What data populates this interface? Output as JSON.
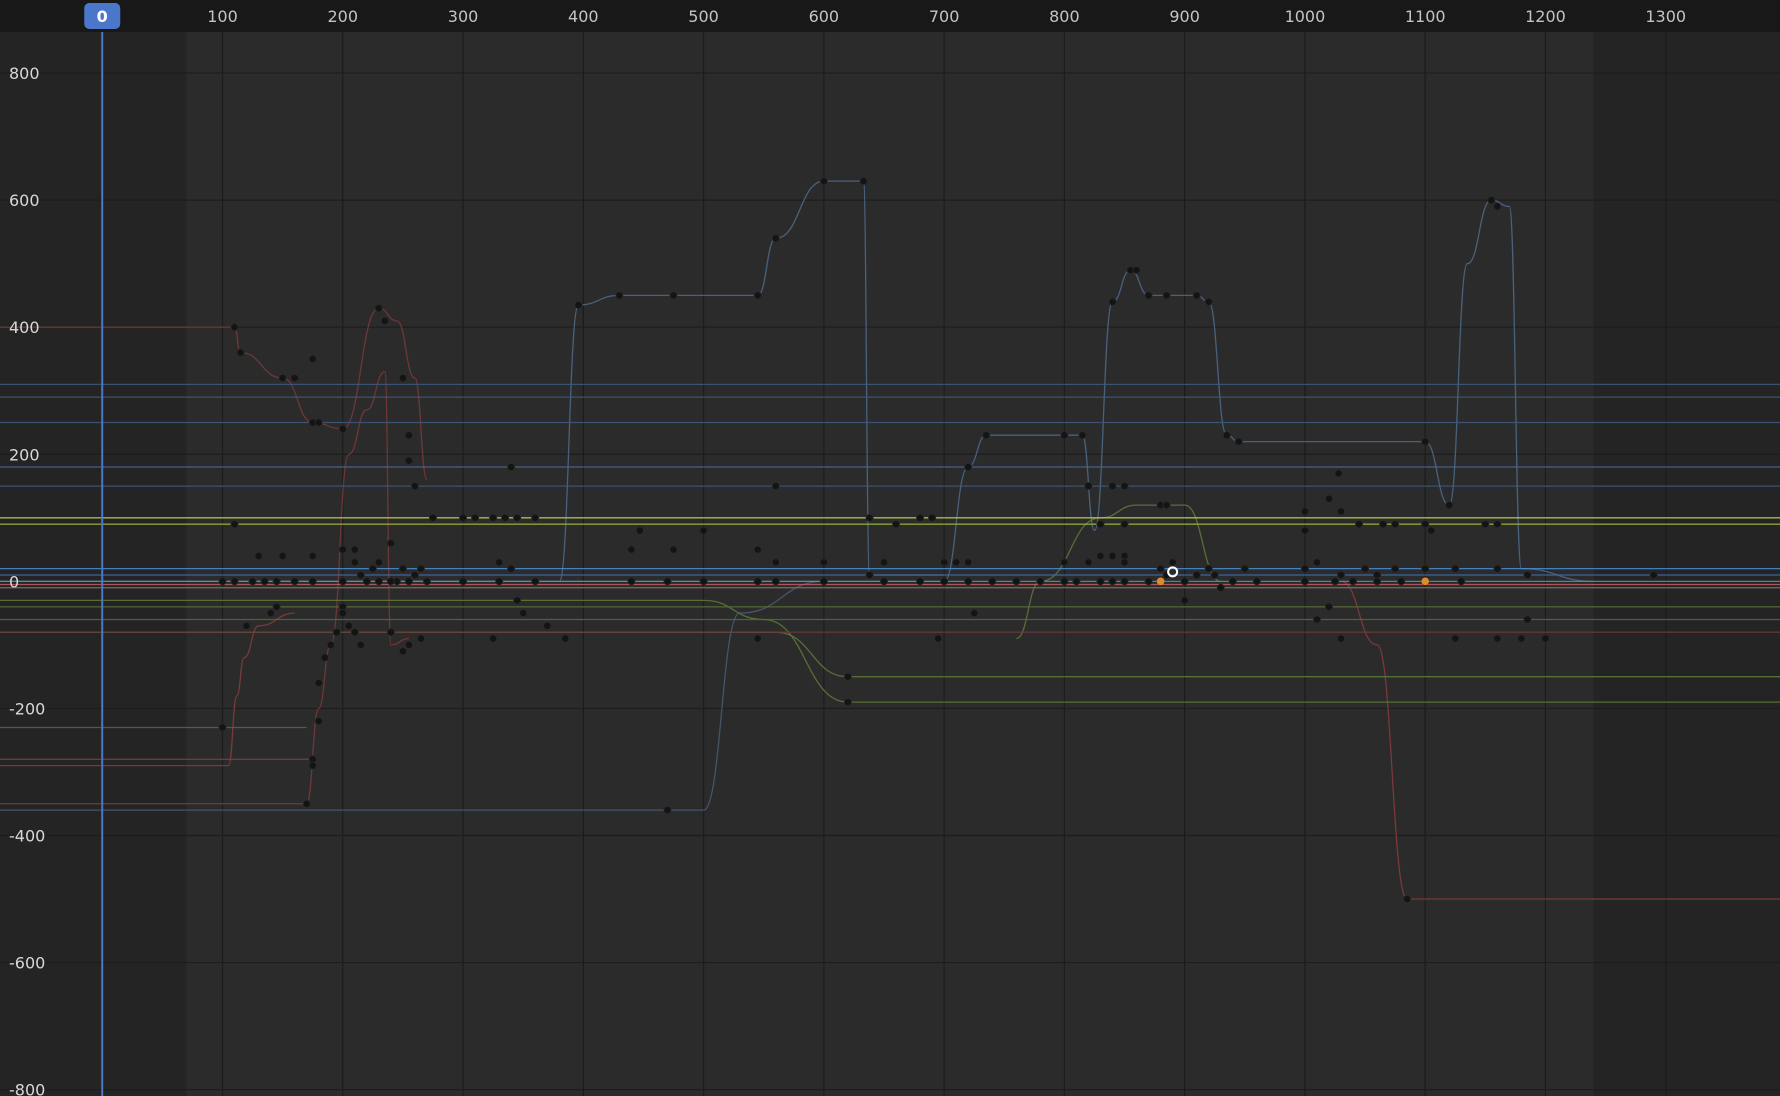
{
  "editor": {
    "type": "graph-editor",
    "current_frame": "0",
    "frame_range": {
      "start": 70,
      "end": 1240
    },
    "frame_ticks": [
      "100",
      "200",
      "300",
      "400",
      "500",
      "600",
      "700",
      "800",
      "900",
      "1000",
      "1100",
      "1200",
      "1300"
    ],
    "value_ticks": [
      "800",
      "600",
      "400",
      "200",
      "0",
      "-200",
      "-400",
      "-600",
      "-800"
    ],
    "colors": {
      "background": "#242424",
      "range_fill": "#2b2b2b",
      "ruler": "#181818",
      "playhead": "#4a77c9",
      "grid": "#1c1c1c"
    }
  },
  "chart_data": {
    "type": "line",
    "xlim": [
      -85,
      1395
    ],
    "ylim": [
      -810,
      915
    ],
    "grid": true,
    "series": [
      {
        "color": "#4d6b8c",
        "points": [
          [
            -90,
            0
          ],
          [
            380,
            0
          ],
          [
            396,
            435
          ],
          [
            430,
            450
          ],
          [
            475,
            450
          ],
          [
            545,
            450
          ],
          [
            560,
            540
          ],
          [
            600,
            630
          ],
          [
            633,
            630
          ],
          [
            638,
            10
          ],
          [
            700,
            10
          ]
        ]
      },
      {
        "color": "#4d6b8c",
        "points": [
          [
            -90,
            0
          ],
          [
            700,
            0
          ],
          [
            720,
            180
          ],
          [
            735,
            230
          ],
          [
            800,
            230
          ],
          [
            815,
            230
          ],
          [
            825,
            80
          ],
          [
            840,
            440
          ],
          [
            855,
            490
          ],
          [
            870,
            450
          ],
          [
            885,
            450
          ],
          [
            910,
            450
          ],
          [
            920,
            440
          ],
          [
            935,
            230
          ],
          [
            945,
            220
          ],
          [
            1100,
            220
          ],
          [
            1120,
            120
          ],
          [
            1135,
            500
          ],
          [
            1155,
            600
          ],
          [
            1170,
            590
          ],
          [
            1180,
            20
          ],
          [
            1240,
            0
          ]
        ]
      },
      {
        "color": "#4a5d74",
        "points": [
          [
            -90,
            -360
          ],
          [
            470,
            -360
          ],
          [
            500,
            -360
          ],
          [
            530,
            -50
          ],
          [
            600,
            0
          ]
        ]
      },
      {
        "color": "#7a3a3a",
        "points": [
          [
            -90,
            400
          ],
          [
            110,
            400
          ],
          [
            115,
            360
          ],
          [
            150,
            320
          ],
          [
            175,
            250
          ],
          [
            200,
            240
          ],
          [
            230,
            430
          ],
          [
            245,
            410
          ],
          [
            260,
            320
          ],
          [
            270,
            160
          ]
        ]
      },
      {
        "color": "#7a3a3a",
        "points": [
          [
            -90,
            -350
          ],
          [
            170,
            -350
          ],
          [
            180,
            -200
          ],
          [
            190,
            -100
          ],
          [
            205,
            200
          ],
          [
            220,
            270
          ],
          [
            235,
            330
          ],
          [
            240,
            -100
          ],
          [
            255,
            -90
          ]
        ]
      },
      {
        "color": "#8a3c3c",
        "points": [
          [
            -90,
            -290
          ],
          [
            105,
            -290
          ],
          [
            112,
            -180
          ],
          [
            118,
            -120
          ],
          [
            130,
            -70
          ],
          [
            160,
            -50
          ]
        ]
      },
      {
        "color": "#8a3c3c",
        "points": [
          [
            1030,
            0
          ],
          [
            1060,
            -100
          ],
          [
            1085,
            -500
          ],
          [
            1395,
            -500
          ]
        ]
      },
      {
        "color": "#5f7a3a",
        "points": [
          [
            -90,
            -30
          ],
          [
            500,
            -30
          ],
          [
            550,
            -60
          ],
          [
            620,
            -190
          ],
          [
            1395,
            -190
          ]
        ]
      },
      {
        "color": "#5f7a3a",
        "points": [
          [
            -90,
            -80
          ],
          [
            560,
            -80
          ],
          [
            620,
            -150
          ],
          [
            1395,
            -150
          ]
        ]
      },
      {
        "color": "#5f7a3a",
        "points": [
          [
            760,
            -90
          ],
          [
            780,
            0
          ],
          [
            830,
            100
          ],
          [
            860,
            120
          ],
          [
            900,
            120
          ],
          [
            930,
            0
          ]
        ]
      },
      {
        "color": "#c4d44a",
        "points": [
          [
            -90,
            100
          ],
          [
            1395,
            100
          ]
        ]
      },
      {
        "color": "#9cb83a",
        "points": [
          [
            -90,
            90
          ],
          [
            1395,
            90
          ]
        ]
      },
      {
        "color": "#4b8fd6",
        "points": [
          [
            -90,
            20
          ],
          [
            1395,
            20
          ]
        ]
      },
      {
        "color": "#3f6fb0",
        "points": [
          [
            -90,
            10
          ],
          [
            1395,
            10
          ]
        ]
      },
      {
        "color": "#5b8fc7",
        "points": [
          [
            -90,
            0
          ],
          [
            1395,
            0
          ]
        ]
      },
      {
        "color": "#c06060",
        "points": [
          [
            -90,
            -5
          ],
          [
            1395,
            -5
          ]
        ]
      },
      {
        "color": "#8a6a6a",
        "points": [
          [
            -90,
            -10
          ],
          [
            1395,
            -10
          ]
        ]
      },
      {
        "color": "#4a6a9a",
        "points": [
          [
            -90,
            180
          ],
          [
            1395,
            180
          ]
        ]
      },
      {
        "color": "#3e5a80",
        "points": [
          [
            -90,
            150
          ],
          [
            1395,
            150
          ]
        ]
      },
      {
        "color": "#3e5a80",
        "points": [
          [
            -90,
            310
          ],
          [
            1395,
            310
          ]
        ]
      },
      {
        "color": "#3e5a80",
        "points": [
          [
            -90,
            290
          ],
          [
            1395,
            290
          ]
        ]
      },
      {
        "color": "#3e5a80",
        "points": [
          [
            -90,
            250
          ],
          [
            1395,
            250
          ]
        ]
      },
      {
        "color": "#566b3a",
        "points": [
          [
            -90,
            -40
          ],
          [
            1395,
            -40
          ]
        ]
      },
      {
        "color": "#566b3a",
        "points": [
          [
            -90,
            -60
          ],
          [
            1395,
            -60
          ]
        ]
      },
      {
        "color": "#6a3a3a",
        "points": [
          [
            -90,
            -80
          ],
          [
            1395,
            -80
          ]
        ]
      },
      {
        "color": "#566b3a",
        "points": [
          [
            -90,
            -230
          ],
          [
            170,
            -230
          ]
        ]
      },
      {
        "color": "#7a4040",
        "points": [
          [
            -90,
            -280
          ],
          [
            175,
            -280
          ]
        ]
      }
    ],
    "keyframes": [
      [
        396,
        435
      ],
      [
        430,
        450
      ],
      [
        475,
        450
      ],
      [
        545,
        450
      ],
      [
        560,
        540
      ],
      [
        600,
        630
      ],
      [
        633,
        630
      ],
      [
        638,
        100
      ],
      [
        638,
        10
      ],
      [
        720,
        180
      ],
      [
        735,
        230
      ],
      [
        800,
        230
      ],
      [
        815,
        230
      ],
      [
        840,
        440
      ],
      [
        855,
        490
      ],
      [
        860,
        490
      ],
      [
        870,
        450
      ],
      [
        885,
        450
      ],
      [
        910,
        450
      ],
      [
        920,
        440
      ],
      [
        935,
        230
      ],
      [
        945,
        220
      ],
      [
        1100,
        220
      ],
      [
        1120,
        120
      ],
      [
        1155,
        600
      ],
      [
        1160,
        590
      ],
      [
        470,
        -360
      ],
      [
        110,
        400
      ],
      [
        115,
        360
      ],
      [
        150,
        320
      ],
      [
        160,
        320
      ],
      [
        175,
        350
      ],
      [
        175,
        250
      ],
      [
        180,
        250
      ],
      [
        200,
        240
      ],
      [
        230,
        430
      ],
      [
        235,
        410
      ],
      [
        250,
        320
      ],
      [
        255,
        230
      ],
      [
        255,
        190
      ],
      [
        260,
        150
      ],
      [
        100,
        -230
      ],
      [
        170,
        -350
      ],
      [
        175,
        -280
      ],
      [
        175,
        -290
      ],
      [
        180,
        -220
      ],
      [
        180,
        -160
      ],
      [
        185,
        -120
      ],
      [
        190,
        -100
      ],
      [
        195,
        -80
      ],
      [
        200,
        -40
      ],
      [
        1085,
        -500
      ],
      [
        340,
        180
      ],
      [
        820,
        150
      ],
      [
        840,
        150
      ],
      [
        850,
        150
      ],
      [
        830,
        40
      ],
      [
        840,
        40
      ],
      [
        850,
        40
      ],
      [
        830,
        90
      ],
      [
        850,
        90
      ],
      [
        440,
        50
      ],
      [
        447,
        80
      ],
      [
        475,
        50
      ],
      [
        500,
        80
      ],
      [
        545,
        50
      ],
      [
        560,
        150
      ],
      [
        680,
        100
      ],
      [
        690,
        100
      ],
      [
        660,
        90
      ],
      [
        880,
        120
      ],
      [
        885,
        120
      ],
      [
        1020,
        130
      ],
      [
        1028,
        170
      ],
      [
        1000,
        110
      ],
      [
        1000,
        80
      ],
      [
        1030,
        110
      ],
      [
        1045,
        90
      ],
      [
        1065,
        90
      ],
      [
        1075,
        90
      ],
      [
        1100,
        90
      ],
      [
        1105,
        80
      ],
      [
        1150,
        90
      ],
      [
        1160,
        90
      ],
      [
        110,
        90
      ],
      [
        130,
        40
      ],
      [
        150,
        40
      ],
      [
        175,
        40
      ],
      [
        200,
        50
      ],
      [
        210,
        50
      ],
      [
        225,
        20
      ],
      [
        240,
        60
      ],
      [
        250,
        20
      ],
      [
        275,
        100
      ],
      [
        300,
        100
      ],
      [
        310,
        100
      ],
      [
        325,
        100
      ],
      [
        335,
        100
      ],
      [
        345,
        100
      ],
      [
        360,
        100
      ],
      [
        120,
        -70
      ],
      [
        140,
        -50
      ],
      [
        145,
        -40
      ],
      [
        200,
        -50
      ],
      [
        205,
        -70
      ],
      [
        210,
        -80
      ],
      [
        215,
        -100
      ],
      [
        240,
        -80
      ],
      [
        250,
        -110
      ],
      [
        255,
        -100
      ],
      [
        265,
        -90
      ],
      [
        325,
        -90
      ],
      [
        370,
        -70
      ],
      [
        385,
        -90
      ],
      [
        545,
        -90
      ],
      [
        620,
        -150
      ],
      [
        620,
        -190
      ],
      [
        695,
        -90
      ],
      [
        725,
        -50
      ],
      [
        1010,
        -60
      ],
      [
        1020,
        -40
      ],
      [
        1030,
        -90
      ],
      [
        1125,
        -90
      ],
      [
        1160,
        -90
      ],
      [
        1180,
        -90
      ],
      [
        1185,
        -60
      ],
      [
        1200,
        -90
      ],
      [
        880,
        20
      ],
      [
        885,
        10
      ],
      [
        890,
        30
      ],
      [
        900,
        -30
      ],
      [
        910,
        10
      ],
      [
        920,
        20
      ],
      [
        925,
        10
      ],
      [
        930,
        -10
      ],
      [
        950,
        20
      ],
      [
        1000,
        20
      ],
      [
        1010,
        30
      ],
      [
        1030,
        10
      ],
      [
        1050,
        20
      ],
      [
        1060,
        10
      ],
      [
        1075,
        20
      ],
      [
        1100,
        20
      ],
      [
        1125,
        20
      ],
      [
        1160,
        20
      ],
      [
        1185,
        10
      ],
      [
        1290,
        10
      ],
      [
        100,
        0
      ],
      [
        110,
        0
      ],
      [
        125,
        0
      ],
      [
        135,
        0
      ],
      [
        145,
        0
      ],
      [
        160,
        0
      ],
      [
        175,
        0
      ],
      [
        200,
        0
      ],
      [
        220,
        0
      ],
      [
        230,
        0
      ],
      [
        245,
        0
      ],
      [
        255,
        0
      ],
      [
        270,
        0
      ],
      [
        300,
        0
      ],
      [
        330,
        0
      ],
      [
        360,
        0
      ],
      [
        440,
        0
      ],
      [
        470,
        0
      ],
      [
        500,
        0
      ],
      [
        545,
        0
      ],
      [
        560,
        0
      ],
      [
        600,
        0
      ],
      [
        650,
        0
      ],
      [
        680,
        0
      ],
      [
        700,
        0
      ],
      [
        720,
        0
      ],
      [
        740,
        0
      ],
      [
        760,
        0
      ],
      [
        780,
        0
      ],
      [
        800,
        0
      ],
      [
        810,
        0
      ],
      [
        830,
        0
      ],
      [
        840,
        0
      ],
      [
        850,
        0
      ],
      [
        870,
        0
      ],
      [
        900,
        0
      ],
      [
        940,
        0
      ],
      [
        960,
        0
      ],
      [
        1000,
        0
      ],
      [
        1025,
        0
      ],
      [
        1040,
        0
      ],
      [
        1060,
        0
      ],
      [
        1080,
        0
      ],
      [
        1100,
        0
      ],
      [
        1130,
        0
      ],
      [
        330,
        30
      ],
      [
        340,
        20
      ],
      [
        345,
        -30
      ],
      [
        350,
        -50
      ],
      [
        210,
        30
      ],
      [
        230,
        30
      ],
      [
        240,
        0
      ],
      [
        215,
        10
      ],
      [
        260,
        10
      ],
      [
        265,
        20
      ],
      [
        560,
        30
      ],
      [
        600,
        30
      ],
      [
        650,
        30
      ],
      [
        700,
        30
      ],
      [
        710,
        30
      ],
      [
        720,
        30
      ],
      [
        800,
        30
      ],
      [
        820,
        30
      ],
      [
        850,
        30
      ]
    ],
    "selected_keyframes": [
      [
        880,
        0
      ],
      [
        1100,
        0
      ]
    ],
    "cursor_marker": [
      890,
      15
    ]
  }
}
